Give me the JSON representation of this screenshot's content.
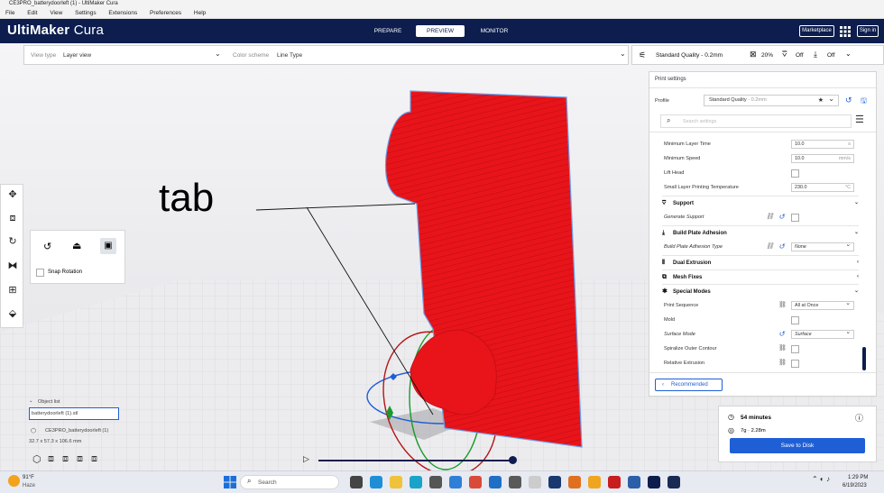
{
  "window": {
    "title": "CE3PRO_batterydoorleft (1) - UltiMaker Cura"
  },
  "menu": [
    "File",
    "Edit",
    "View",
    "Settings",
    "Extensions",
    "Preferences",
    "Help"
  ],
  "header": {
    "logo_bold": "UltiMaker",
    "logo_thin": "Cura",
    "stages": [
      "PREPARE",
      "PREVIEW",
      "MONITOR"
    ],
    "active_stage": "PREVIEW",
    "marketplace": "Marketplace",
    "signin": "Sign in"
  },
  "viewbar": {
    "view_type_label": "View type",
    "view_type_value": "Layer view",
    "color_scheme_label": "Color scheme",
    "color_scheme_value": "Line Type"
  },
  "quality": {
    "profile": "Standard Quality - 0.2mm",
    "infill": "20%",
    "support": "Off",
    "adhesion": "Off"
  },
  "annotation": {
    "text": "tab"
  },
  "print_settings": {
    "title": "Print settings",
    "profile_label": "Profile",
    "profile_value": "Standard Quality",
    "profile_suffix": " - 0.2mm",
    "search_placeholder": "Search settings",
    "rows": [
      {
        "label": "Minimum Layer Time",
        "value": "10.0",
        "unit": "s"
      },
      {
        "label": "Minimum Speed",
        "value": "10.0",
        "unit": "mm/s"
      },
      {
        "label": "Lift Head"
      },
      {
        "label": "Small Layer Printing Temperature",
        "value": "230.0",
        "unit": "°C"
      }
    ],
    "support_cat": "Support",
    "generate_support": "Generate Support",
    "adhesion_cat": "Build Plate Adhesion",
    "adhesion_type_label": "Build Plate Adhesion Type",
    "adhesion_type_value": "None",
    "dual_cat": "Dual Extrusion",
    "mesh_cat": "Mesh Fixes",
    "special_cat": "Special Modes",
    "print_sequence_label": "Print Sequence",
    "print_sequence_value": "All at Once",
    "mold_label": "Mold",
    "surface_mode_label": "Surface Mode",
    "surface_mode_value": "Surface",
    "spiralize_label": "Spiralize Outer Contour",
    "relative_label": "Relative Extrusion",
    "recommended_button": "Recommended"
  },
  "estimate": {
    "time": "54 minutes",
    "material": "7g · 2.28m",
    "save_button": "Save to Disk"
  },
  "rotate_panel": {
    "snap_rotation": "Snap Rotation"
  },
  "object_list": {
    "title": "Object list",
    "field_value": "batterydoorleft (1).stl",
    "item": "CE3PRO_batterydoorleft (1)",
    "dimensions": "32.7 x 57.3 x 106.6 mm"
  },
  "taskbar": {
    "weather_temp": "91°F",
    "weather_desc": "Haze",
    "search_placeholder": "Search",
    "time": "1:29 PM",
    "date": "6/19/2023"
  },
  "colors": {
    "header": "#0c1d4e",
    "accent": "#1f5fd6",
    "model": "#e8141a"
  }
}
